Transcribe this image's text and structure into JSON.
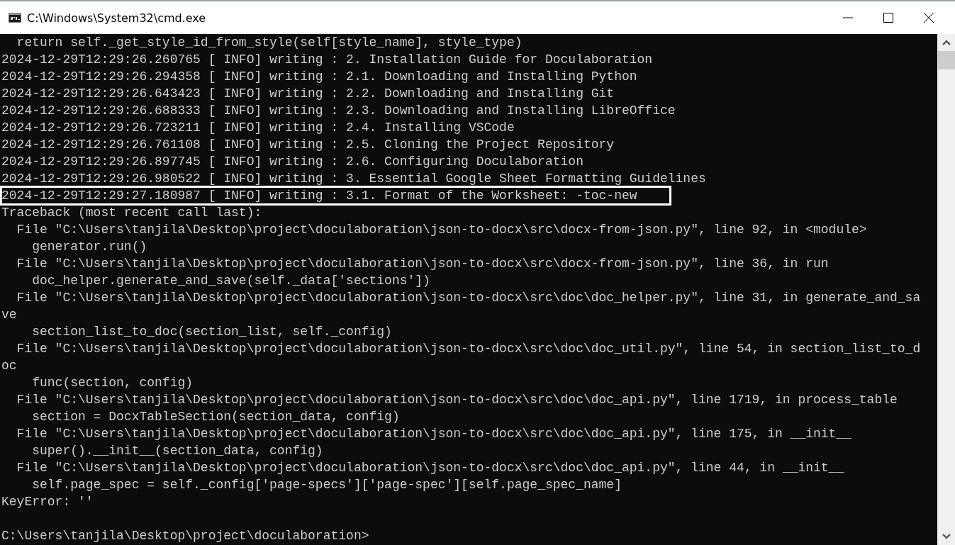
{
  "window": {
    "title": "C:\\Windows\\System32\\cmd.exe"
  },
  "console": {
    "lines": [
      {
        "text": "  return self._get_style_id_from_style(self[style_name], style_type)",
        "highlighted": false
      },
      {
        "text": "2024-12-29T12:29:26.260765 [ INFO] writing : 2. Installation Guide for Doculaboration",
        "highlighted": false
      },
      {
        "text": "2024-12-29T12:29:26.294358 [ INFO] writing : 2.1. Downloading and Installing Python",
        "highlighted": false
      },
      {
        "text": "2024-12-29T12:29:26.643423 [ INFO] writing : 2.2. Downloading and Installing Git",
        "highlighted": false
      },
      {
        "text": "2024-12-29T12:29:26.688333 [ INFO] writing : 2.3. Downloading and Installing LibreOffice",
        "highlighted": false
      },
      {
        "text": "2024-12-29T12:29:26.723211 [ INFO] writing : 2.4. Installing VSCode",
        "highlighted": false
      },
      {
        "text": "2024-12-29T12:29:26.761108 [ INFO] writing : 2.5. Cloning the Project Repository",
        "highlighted": false
      },
      {
        "text": "2024-12-29T12:29:26.897745 [ INFO] writing : 2.6. Configuring Doculaboration",
        "highlighted": false
      },
      {
        "text": "2024-12-29T12:29:26.980522 [ INFO] writing : 3. Essential Google Sheet Formatting Guidelines",
        "highlighted": false
      },
      {
        "text": "2024-12-29T12:29:27.180987 [ INFO] writing : 3.1. Format of the Worksheet: -toc-new",
        "highlighted": true
      },
      {
        "text": "Traceback (most recent call last):",
        "highlighted": false
      },
      {
        "text": "  File \"C:\\Users\\tanjila\\Desktop\\project\\doculaboration\\json-to-docx\\src\\docx-from-json.py\", line 92, in <module>",
        "highlighted": false
      },
      {
        "text": "    generator.run()",
        "highlighted": false
      },
      {
        "text": "  File \"C:\\Users\\tanjila\\Desktop\\project\\doculaboration\\json-to-docx\\src\\docx-from-json.py\", line 36, in run",
        "highlighted": false
      },
      {
        "text": "    doc_helper.generate_and_save(self._data['sections'])",
        "highlighted": false
      },
      {
        "text": "  File \"C:\\Users\\tanjila\\Desktop\\project\\doculaboration\\json-to-docx\\src\\doc\\doc_helper.py\", line 31, in generate_and_sa",
        "highlighted": false
      },
      {
        "text": "ve",
        "highlighted": false
      },
      {
        "text": "    section_list_to_doc(section_list, self._config)",
        "highlighted": false
      },
      {
        "text": "  File \"C:\\Users\\tanjila\\Desktop\\project\\doculaboration\\json-to-docx\\src\\doc\\doc_util.py\", line 54, in section_list_to_d",
        "highlighted": false
      },
      {
        "text": "oc",
        "highlighted": false
      },
      {
        "text": "    func(section, config)",
        "highlighted": false
      },
      {
        "text": "  File \"C:\\Users\\tanjila\\Desktop\\project\\doculaboration\\json-to-docx\\src\\doc\\doc_api.py\", line 1719, in process_table",
        "highlighted": false
      },
      {
        "text": "    section = DocxTableSection(section_data, config)",
        "highlighted": false
      },
      {
        "text": "  File \"C:\\Users\\tanjila\\Desktop\\project\\doculaboration\\json-to-docx\\src\\doc\\doc_api.py\", line 175, in __init__",
        "highlighted": false
      },
      {
        "text": "    super().__init__(section_data, config)",
        "highlighted": false
      },
      {
        "text": "  File \"C:\\Users\\tanjila\\Desktop\\project\\doculaboration\\json-to-docx\\src\\doc\\doc_api.py\", line 44, in __init__",
        "highlighted": false
      },
      {
        "text": "    self.page_spec = self._config['page-specs']['page-spec'][self.page_spec_name]",
        "highlighted": false
      },
      {
        "text": "KeyError: ''",
        "highlighted": false
      }
    ],
    "prompt": "C:\\Users\\tanjila\\Desktop\\project\\doculaboration>"
  }
}
